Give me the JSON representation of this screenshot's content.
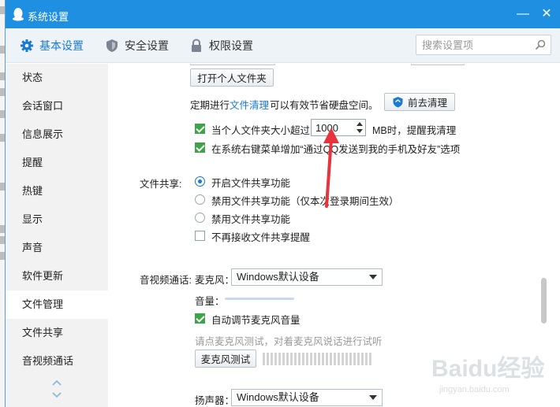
{
  "window": {
    "title": "系统设置",
    "minimize_glyph": "—",
    "close_glyph": "✕"
  },
  "tabs": [
    {
      "label": "基本设置",
      "icon": "gear-icon",
      "active": true
    },
    {
      "label": "安全设置",
      "icon": "shield-icon",
      "active": false
    },
    {
      "label": "权限设置",
      "icon": "lock-icon",
      "active": false
    }
  ],
  "search": {
    "placeholder": "搜索设置项",
    "value": ""
  },
  "sidebar": {
    "items": [
      {
        "label": "状态"
      },
      {
        "label": "会话窗口"
      },
      {
        "label": "信息展示"
      },
      {
        "label": "提醒"
      },
      {
        "label": "热键"
      },
      {
        "label": "显示"
      },
      {
        "label": "声音"
      },
      {
        "label": "软件更新"
      },
      {
        "label": "文件管理",
        "active": true
      },
      {
        "label": "文件共享"
      },
      {
        "label": "音视频通话"
      }
    ]
  },
  "file_mgmt": {
    "open_folder_button": "打开个人文件夹",
    "cleanup_prefix": "定期进行",
    "cleanup_link": "文件清理",
    "cleanup_suffix": "可以有效节省硬盘空间。",
    "go_clean_button": "前去清理",
    "auto_clean_label": "当个人文件夹大小超过",
    "auto_clean_value": "1000",
    "auto_clean_suffix": "MB时，提醒我清理",
    "auto_clean_checked": true,
    "context_menu_label": "在系统右键菜单增加“通过QQ发送到我的手机及好友”选项",
    "context_menu_checked": true
  },
  "file_share": {
    "section_label": "文件共享:",
    "options": [
      {
        "label": "开启文件共享功能",
        "selected": true
      },
      {
        "label": "禁用文件共享功能（仅本次登录期间生效）",
        "selected": false
      },
      {
        "label": "禁用文件共享功能",
        "selected": false
      }
    ],
    "no_prompt_label": "不再接收文件共享提醒",
    "no_prompt_checked": false
  },
  "av_call": {
    "section_label": "音视频通话:",
    "mic_label": "麦克风：",
    "mic_device": "Windows默认设备",
    "volume_label": "音量：",
    "auto_adjust_label": "自动调节麦克风音量",
    "auto_adjust_checked": true,
    "mic_test_hint": "请点麦克风测试，对着麦克风说话进行试听",
    "mic_test_button": "麦克风测试",
    "speaker_label": "扬声器：",
    "speaker_device": "Windows默认设备"
  },
  "watermark": {
    "brand": "Baidu经验",
    "url": "jingyan.baidu.com"
  },
  "colors": {
    "titlebar": "#1e8fe1",
    "accent": "#1a7ad0",
    "checkbox": "#3da447",
    "annotation": "#e8333a"
  }
}
